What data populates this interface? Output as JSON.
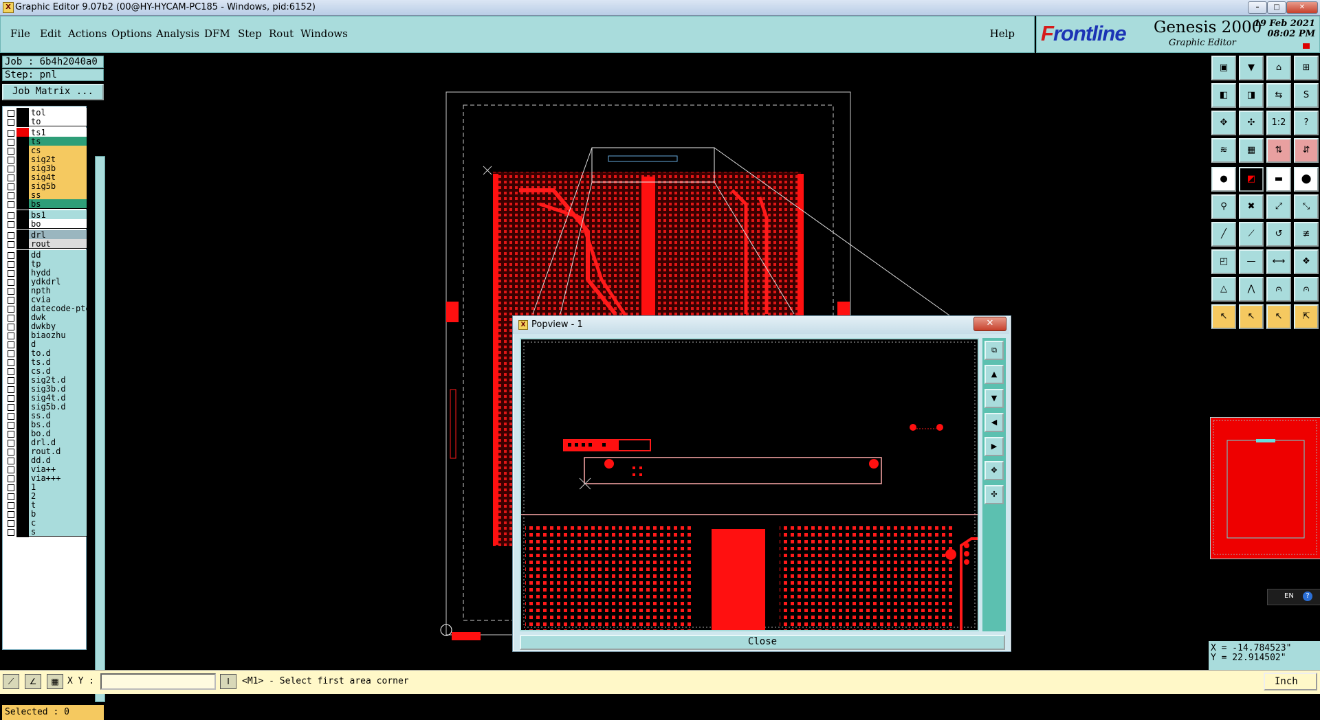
{
  "window": {
    "title": "Graphic Editor 9.07b2 (00@HY-HYCAM-PC185 - Windows, pid:6152)",
    "min_label": "–",
    "max_label": "□",
    "close_label": "✕"
  },
  "menu": {
    "items": [
      "File",
      "Edit",
      "Actions",
      "Options",
      "Analysis",
      "DFM",
      "Step",
      "Rout",
      "Windows"
    ],
    "help": "Help"
  },
  "brand": {
    "logo_pre": "F",
    "logo_post": "rontline",
    "product": "Genesis 2000",
    "subtitle": "Graphic Editor",
    "date": "19 Feb 2021",
    "time": "08:02 PM"
  },
  "job": {
    "job_label": "Job : 6b4h2040a0",
    "step_label": "Step: pnl",
    "matrix_button": "Job Matrix ..."
  },
  "layers": [
    {
      "name": "tol",
      "color": "#ffffff"
    },
    {
      "name": "to",
      "color": "#ffffff"
    },
    {
      "name": "ts1",
      "color": "#ffffff",
      "gap": true
    },
    {
      "name": "ts",
      "color": "#2e9e78"
    },
    {
      "name": "cs",
      "color": "#f5c960"
    },
    {
      "name": "sig2t",
      "color": "#f5c960"
    },
    {
      "name": "sig3b",
      "color": "#f5c960"
    },
    {
      "name": "sig4t",
      "color": "#f5c960"
    },
    {
      "name": "sig5b",
      "color": "#f5c960"
    },
    {
      "name": "ss",
      "color": "#f5c960"
    },
    {
      "name": "bs",
      "color": "#2e9e78"
    },
    {
      "name": "bs1",
      "color": "#a9dcdc",
      "gap": true
    },
    {
      "name": "bo",
      "color": "#ffffff"
    },
    {
      "name": "drl",
      "color": "#9ab6bf",
      "gap": true
    },
    {
      "name": "rout",
      "color": "#dcdcdc"
    },
    {
      "name": "dd",
      "color": "#a9dcdc",
      "gap": true
    },
    {
      "name": "tp",
      "color": "#a9dcdc"
    },
    {
      "name": "hydd",
      "color": "#a9dcdc"
    },
    {
      "name": "ydkdrl",
      "color": "#a9dcdc"
    },
    {
      "name": "npth",
      "color": "#a9dcdc"
    },
    {
      "name": "cvia",
      "color": "#a9dcdc"
    },
    {
      "name": "datecode-pte",
      "color": "#a9dcdc"
    },
    {
      "name": "dwk",
      "color": "#a9dcdc"
    },
    {
      "name": "dwkby",
      "color": "#a9dcdc"
    },
    {
      "name": "biaozhu",
      "color": "#a9dcdc"
    },
    {
      "name": "d",
      "color": "#a9dcdc"
    },
    {
      "name": "to.d",
      "color": "#a9dcdc"
    },
    {
      "name": "ts.d",
      "color": "#a9dcdc"
    },
    {
      "name": "cs.d",
      "color": "#a9dcdc"
    },
    {
      "name": "sig2t.d",
      "color": "#a9dcdc"
    },
    {
      "name": "sig3b.d",
      "color": "#a9dcdc"
    },
    {
      "name": "sig4t.d",
      "color": "#a9dcdc"
    },
    {
      "name": "sig5b.d",
      "color": "#a9dcdc"
    },
    {
      "name": "ss.d",
      "color": "#a9dcdc"
    },
    {
      "name": "bs.d",
      "color": "#a9dcdc"
    },
    {
      "name": "bo.d",
      "color": "#a9dcdc"
    },
    {
      "name": "drl.d",
      "color": "#a9dcdc"
    },
    {
      "name": "rout.d",
      "color": "#a9dcdc"
    },
    {
      "name": "dd.d",
      "color": "#a9dcdc"
    },
    {
      "name": "via++",
      "color": "#a9dcdc"
    },
    {
      "name": "via+++",
      "color": "#a9dcdc"
    },
    {
      "name": "1",
      "color": "#a9dcdc"
    },
    {
      "name": "2",
      "color": "#a9dcdc"
    },
    {
      "name": "t",
      "color": "#a9dcdc"
    },
    {
      "name": "b",
      "color": "#a9dcdc"
    },
    {
      "name": "c",
      "color": "#a9dcdc"
    },
    {
      "name": "s",
      "color": "#a9dcdc"
    }
  ],
  "status": {
    "selected": "Selected : 0",
    "xy_label": "X Y :",
    "prompt": "<M1> - Select first area corner",
    "units": "Inch",
    "lang": "EN"
  },
  "coords": {
    "x": "X = -14.784523\"",
    "y": "Y = 22.914502\""
  },
  "popview": {
    "title": "Popview - 1",
    "close_button": "Close"
  },
  "colors": {
    "panel": "#a9dcdc",
    "copper": "#ff0000",
    "accent_yellow": "#f5c960"
  }
}
